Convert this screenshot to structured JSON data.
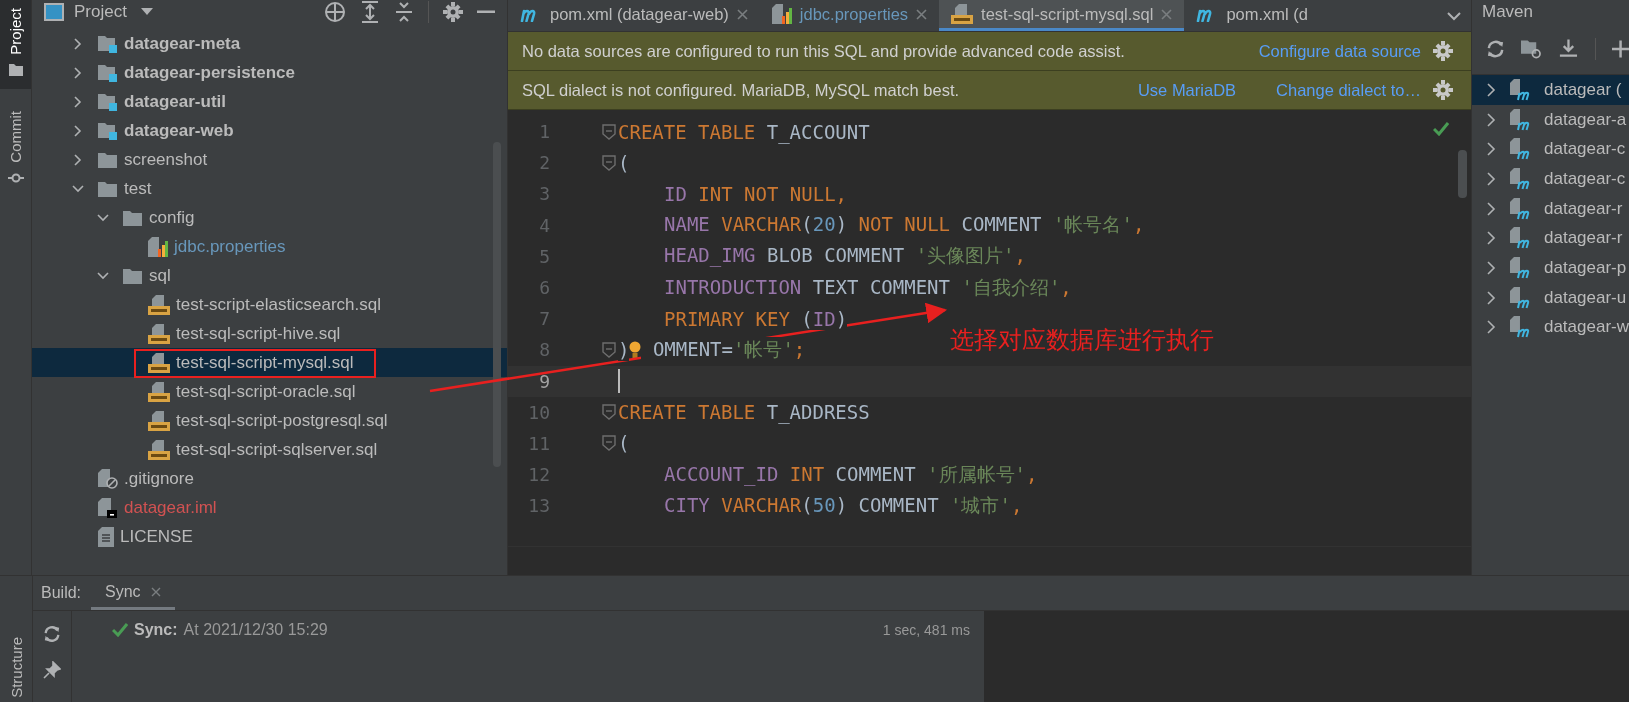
{
  "side_tabs": [
    {
      "label": "Project",
      "kind": "folder",
      "selected": true
    },
    {
      "label": "Commit",
      "kind": "commit",
      "selected": false
    }
  ],
  "bottom_side_tabs": [
    {
      "label": "Structure",
      "selected": false
    }
  ],
  "project": {
    "title": "Project",
    "tree": [
      {
        "label": "datagear-meta",
        "kind": "module",
        "expanded": false,
        "selected": false,
        "highlighted": false
      },
      {
        "label": "datagear-persistence",
        "kind": "module",
        "expanded": false,
        "selected": false,
        "highlighted": false
      },
      {
        "label": "datagear-util",
        "kind": "module",
        "expanded": false,
        "selected": false,
        "highlighted": false
      },
      {
        "label": "datagear-web",
        "kind": "module",
        "expanded": false,
        "selected": false,
        "highlighted": false
      },
      {
        "label": "screenshot",
        "kind": "folder",
        "expanded": false,
        "selected": false,
        "highlighted": false
      },
      {
        "label": "test",
        "kind": "folder",
        "expanded": true,
        "selected": false,
        "highlighted": false,
        "children": [
          {
            "label": "config",
            "kind": "folder",
            "expanded": true,
            "selected": false,
            "highlighted": false,
            "children": [
              {
                "label": "jdbc.properties",
                "kind": "properties",
                "color": "#6897bb",
                "selected": false,
                "highlighted": false
              }
            ]
          },
          {
            "label": "sql",
            "kind": "folder",
            "expanded": true,
            "selected": false,
            "highlighted": false,
            "children": [
              {
                "label": "test-script-elasticsearch.sql",
                "kind": "sql",
                "selected": false,
                "highlighted": false
              },
              {
                "label": "test-sql-script-hive.sql",
                "kind": "sql",
                "selected": false,
                "highlighted": false
              },
              {
                "label": "test-sql-script-mysql.sql",
                "kind": "sql",
                "selected": true,
                "highlighted": true
              },
              {
                "label": "test-sql-script-oracle.sql",
                "kind": "sql",
                "selected": false,
                "highlighted": false
              },
              {
                "label": "test-sql-script-postgresql.sql",
                "kind": "sql",
                "selected": false,
                "highlighted": false
              },
              {
                "label": "test-sql-script-sqlserver.sql",
                "kind": "sql",
                "selected": false,
                "highlighted": false
              }
            ]
          }
        ]
      },
      {
        "label": ".gitignore",
        "kind": "ignore",
        "selected": false,
        "highlighted": false
      },
      {
        "label": "datagear.iml",
        "kind": "iml",
        "color": "#d25252",
        "selected": false,
        "highlighted": false
      },
      {
        "label": "LICENSE",
        "kind": "text",
        "selected": false,
        "highlighted": false
      }
    ]
  },
  "editor": {
    "tabs": [
      {
        "label": "pom.xml (datagear-web)",
        "kind": "maven",
        "closable": true,
        "selected": false
      },
      {
        "label": "jdbc.properties",
        "kind": "properties",
        "color": "#6897bb",
        "closable": true,
        "selected": false
      },
      {
        "label": "test-sql-script-mysql.sql",
        "kind": "sql",
        "closable": true,
        "selected": true
      },
      {
        "label": "pom.xml (d",
        "kind": "maven",
        "closable": false,
        "selected": false
      }
    ],
    "banners": [
      {
        "text": "No data sources are configured to run this SQL and provide advanced code assist.",
        "links": [
          "Configure data source"
        ]
      },
      {
        "text": "SQL dialect is not configured. MariaDB, MySQL match best.",
        "links": [
          "Use MariaDB",
          "Change dialect to…"
        ]
      }
    ],
    "lines": [
      {
        "number": "1",
        "fold": true,
        "indented": false,
        "current": false,
        "tokens": [
          {
            "t": "CREATE TABLE",
            "kind": "kw"
          },
          {
            "t": " T_ACCOUNT",
            "kind": "plain"
          }
        ]
      },
      {
        "number": "2",
        "fold": true,
        "indented": false,
        "current": false,
        "tokens": [
          {
            "t": "(",
            "kind": "plain"
          }
        ]
      },
      {
        "number": "3",
        "fold": false,
        "indented": true,
        "current": false,
        "tokens": [
          {
            "t": "ID",
            "kind": "col"
          },
          {
            "t": " INT NOT NULL,",
            "kind": "kw"
          }
        ]
      },
      {
        "number": "4",
        "fold": false,
        "indented": true,
        "current": false,
        "tokens": [
          {
            "t": "NAME",
            "kind": "col"
          },
          {
            "t": " VARCHAR",
            "kind": "kw"
          },
          {
            "t": "(",
            "kind": "plain"
          },
          {
            "t": "20",
            "kind": "num"
          },
          {
            "t": ")",
            "kind": "plain"
          },
          {
            "t": " NOT NULL",
            "kind": "kw"
          },
          {
            "t": " COMMENT ",
            "kind": "plain"
          },
          {
            "t": "'帐号名'",
            "kind": "str"
          },
          {
            "t": ",",
            "kind": "kw"
          }
        ]
      },
      {
        "number": "5",
        "fold": false,
        "indented": true,
        "current": false,
        "tokens": [
          {
            "t": "HEAD_IMG",
            "kind": "col"
          },
          {
            "t": " BLOB COMMENT ",
            "kind": "plain"
          },
          {
            "t": "'头像图片'",
            "kind": "str"
          },
          {
            "t": ",",
            "kind": "kw"
          }
        ]
      },
      {
        "number": "6",
        "fold": false,
        "indented": true,
        "current": false,
        "tokens": [
          {
            "t": "INTRODUCTION",
            "kind": "col"
          },
          {
            "t": " TEXT COMMENT ",
            "kind": "plain"
          },
          {
            "t": "'自我介绍'",
            "kind": "str"
          },
          {
            "t": ",",
            "kind": "kw"
          }
        ]
      },
      {
        "number": "7",
        "fold": false,
        "indented": true,
        "current": false,
        "tokens": [
          {
            "t": "PRIMARY KEY",
            "kind": "kw"
          },
          {
            "t": " (",
            "kind": "plain"
          },
          {
            "t": "ID",
            "kind": "col"
          },
          {
            "t": ")",
            "kind": "plain"
          }
        ]
      },
      {
        "number": "8",
        "fold": true,
        "indented": false,
        "current": false,
        "bulb": true,
        "tokens": [
          {
            "t": ")",
            "kind": "plain"
          },
          {
            "t": " OMMENT=",
            "kind": "plain"
          },
          {
            "t": "'帐号'",
            "kind": "str"
          },
          {
            "t": ";",
            "kind": "kw"
          }
        ]
      },
      {
        "number": "9",
        "fold": false,
        "indented": false,
        "current": true
      },
      {
        "number": "10",
        "fold": true,
        "indented": false,
        "current": false,
        "tokens": [
          {
            "t": "CREATE TABLE",
            "kind": "kw"
          },
          {
            "t": " T_ADDRESS",
            "kind": "plain"
          }
        ]
      },
      {
        "number": "11",
        "fold": true,
        "indented": false,
        "current": false,
        "tokens": [
          {
            "t": "(",
            "kind": "plain"
          }
        ]
      },
      {
        "number": "12",
        "fold": false,
        "indented": true,
        "current": false,
        "tokens": [
          {
            "t": "ACCOUNT_ID",
            "kind": "col"
          },
          {
            "t": " INT",
            "kind": "kw"
          },
          {
            "t": " COMMENT ",
            "kind": "plain"
          },
          {
            "t": "'所属帐号'",
            "kind": "str"
          },
          {
            "t": ",",
            "kind": "kw"
          }
        ]
      },
      {
        "number": "13",
        "fold": false,
        "indented": true,
        "current": false,
        "tokens": [
          {
            "t": "CITY",
            "kind": "col"
          },
          {
            "t": " VARCHAR",
            "kind": "kw"
          },
          {
            "t": "(",
            "kind": "plain"
          },
          {
            "t": "50",
            "kind": "num"
          },
          {
            "t": ")",
            "kind": "plain"
          },
          {
            "t": " COMMENT ",
            "kind": "plain"
          },
          {
            "t": "'城市'",
            "kind": "str"
          },
          {
            "t": ",",
            "kind": "kw"
          }
        ]
      }
    ]
  },
  "annotation": {
    "text": "选择对应数据库进行执行"
  },
  "maven": {
    "title": "Maven",
    "items": [
      {
        "label": "datagear (",
        "selected": true
      },
      {
        "label": "datagear-a",
        "selected": false
      },
      {
        "label": "datagear-c",
        "selected": false
      },
      {
        "label": "datagear-c",
        "selected": false
      },
      {
        "label": "datagear-r",
        "selected": false
      },
      {
        "label": "datagear-r",
        "selected": false
      },
      {
        "label": "datagear-p",
        "selected": false
      },
      {
        "label": "datagear-u",
        "selected": false
      },
      {
        "label": "datagear-w",
        "selected": false
      }
    ]
  },
  "build": {
    "label": "Build:",
    "tabs": [
      {
        "label": "Sync",
        "selected": true
      }
    ],
    "status": {
      "label": "Sync:",
      "text": "At 2021/12/30 15:29",
      "duration": "1 sec, 481 ms"
    }
  }
}
